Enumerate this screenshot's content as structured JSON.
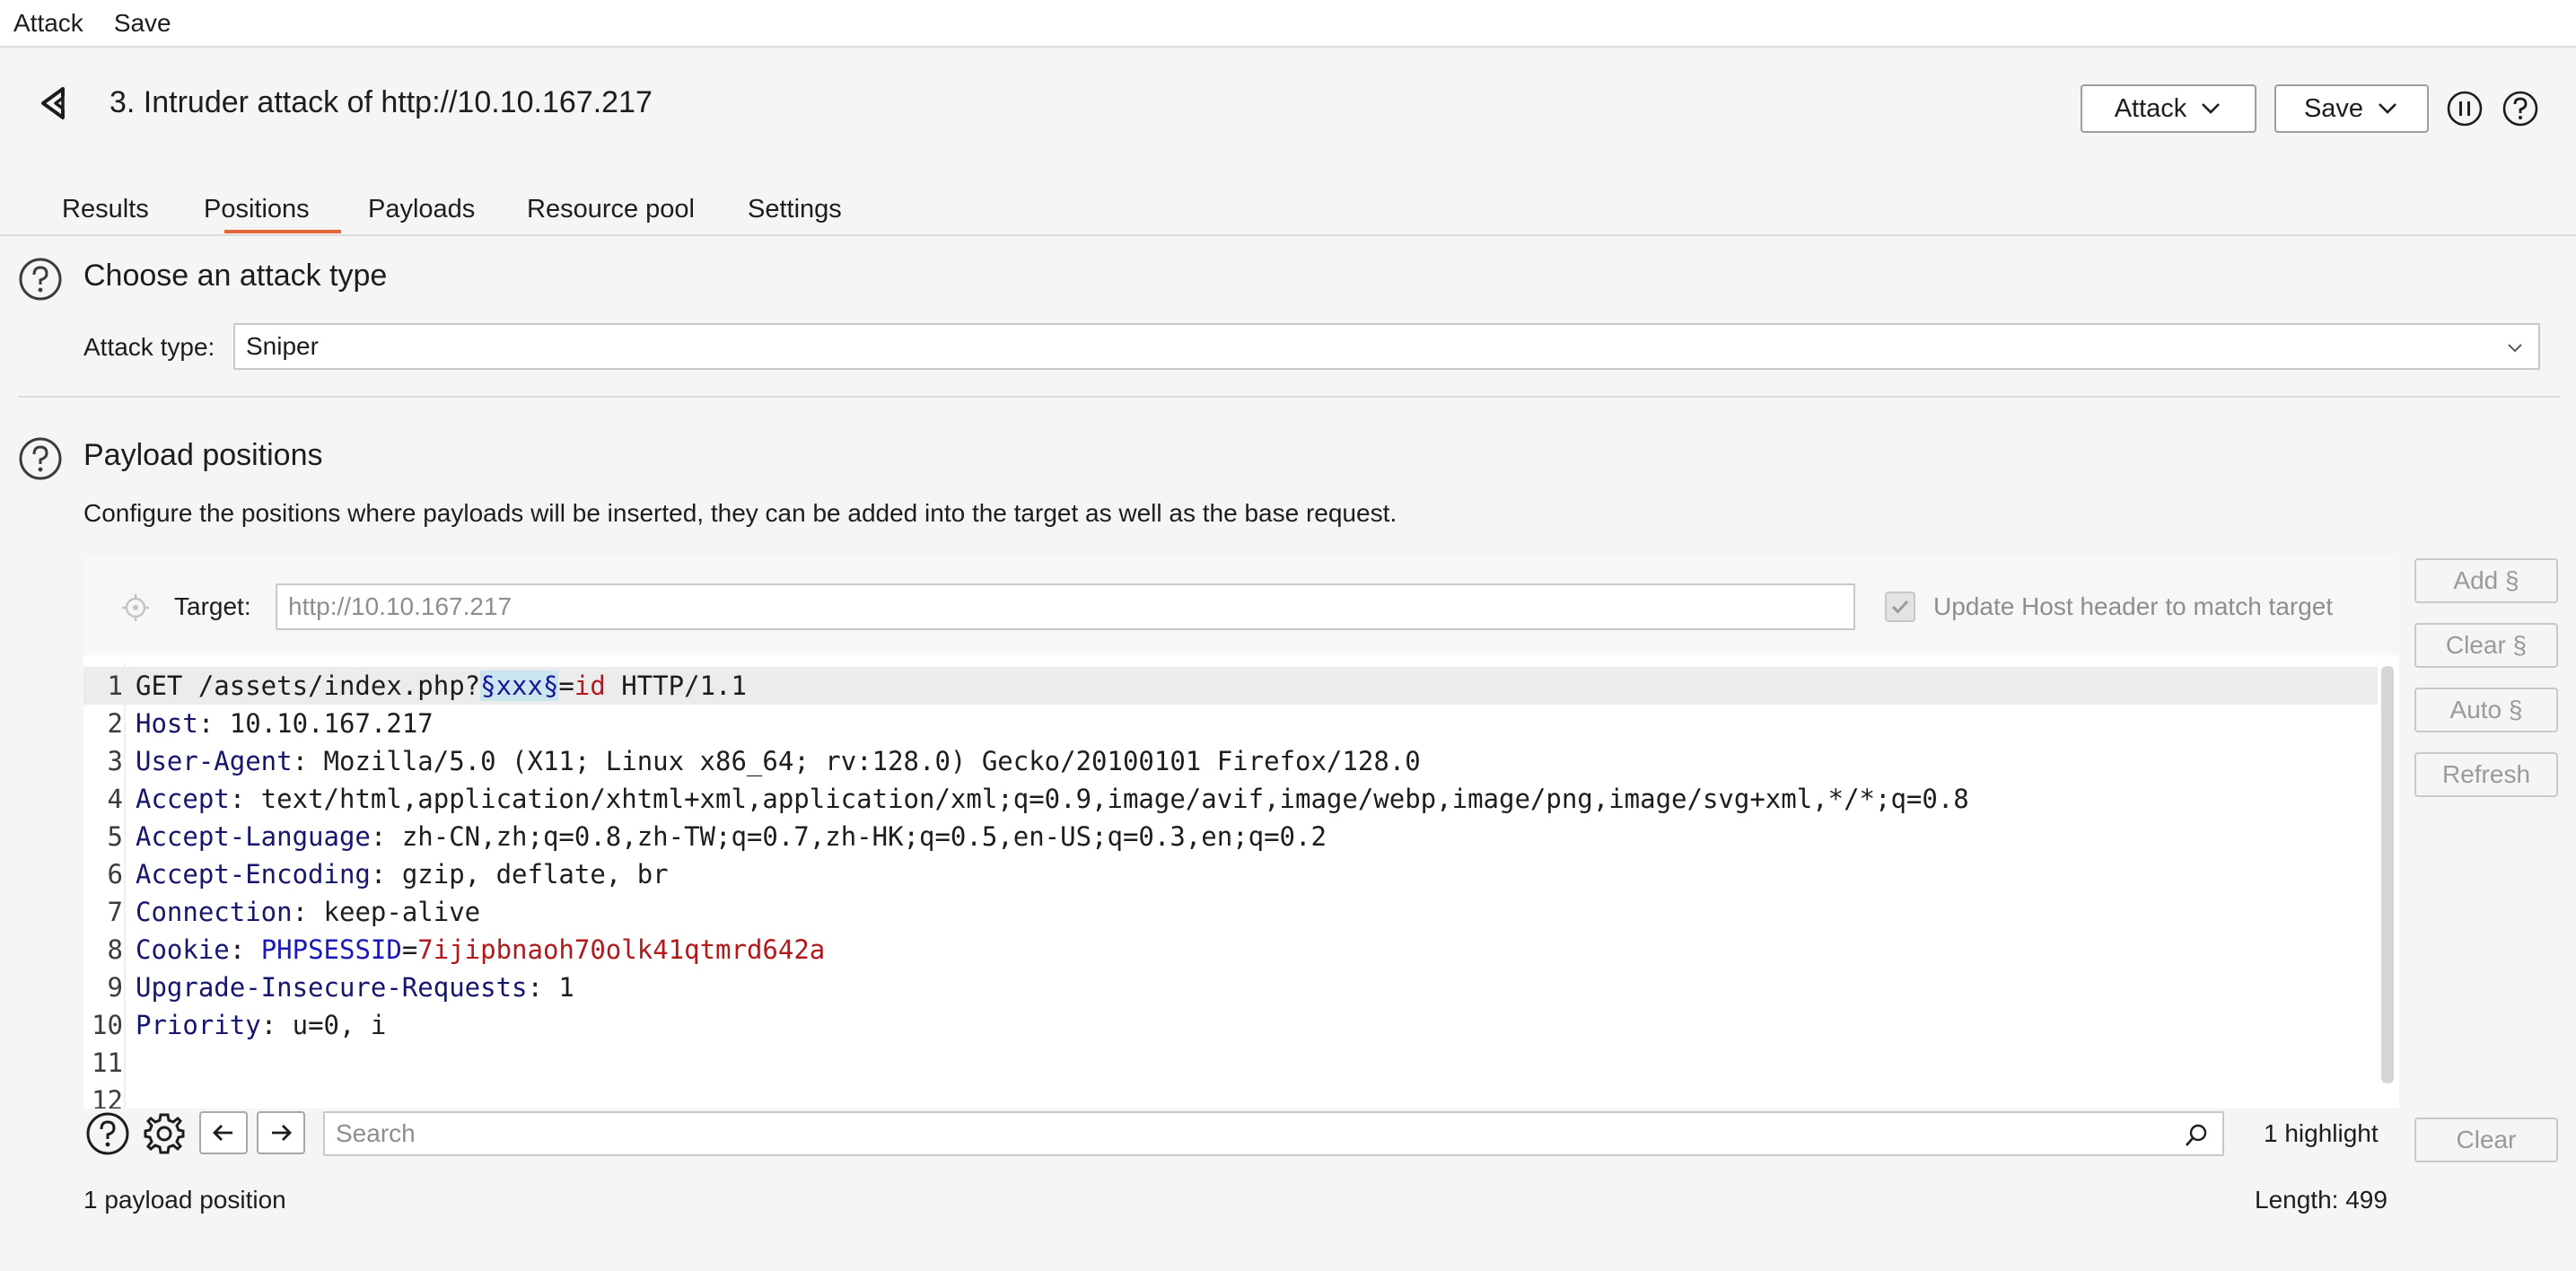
{
  "menubar": {
    "items": [
      "Attack",
      "Save"
    ]
  },
  "header": {
    "title": "3. Intruder attack of http://10.10.167.217",
    "attack_btn": "Attack",
    "save_btn": "Save"
  },
  "tabs": [
    "Results",
    "Positions",
    "Payloads",
    "Resource pool",
    "Settings"
  ],
  "active_tab": "Positions",
  "attack_type_section": {
    "title": "Choose an attack type",
    "label": "Attack type:",
    "value": "Sniper"
  },
  "payload_section": {
    "title": "Payload positions",
    "description": "Configure the positions where payloads will be inserted, they can be added into the target as well as the base request.",
    "target_label": "Target:",
    "target_placeholder": "http://10.10.167.217",
    "update_host_label": "Update Host header to match target",
    "update_host_checked": true
  },
  "side_buttons": [
    "Add §",
    "Clear §",
    "Auto §",
    "Refresh"
  ],
  "request": {
    "line1": {
      "method_path": "GET /assets/index.php?",
      "marker": "§xxx§",
      "eq": "=",
      "param_val": "id",
      "rest": " HTTP/1.1"
    },
    "headers": [
      {
        "n": "2",
        "name": "Host",
        "value": ": 10.10.167.217"
      },
      {
        "n": "3",
        "name": "User-Agent",
        "value": ": Mozilla/5.0 (X11; Linux x86_64; rv:128.0) Gecko/20100101 Firefox/128.0"
      },
      {
        "n": "4",
        "name": "Accept",
        "value": ": text/html,application/xhtml+xml,application/xml;q=0.9,image/avif,image/webp,image/png,image/svg+xml,*/*;q=0.8"
      },
      {
        "n": "5",
        "name": "Accept-Language",
        "value": ": zh-CN,zh;q=0.8,zh-TW;q=0.7,zh-HK;q=0.5,en-US;q=0.3,en;q=0.2"
      },
      {
        "n": "6",
        "name": "Accept-Encoding",
        "value": ": gzip, deflate, br"
      },
      {
        "n": "7",
        "name": "Connection",
        "value": ": keep-alive"
      }
    ],
    "cookie": {
      "n": "8",
      "name": "Cookie",
      "sep": ": ",
      "cname": "PHPSESSID",
      "eq": "=",
      "cval": "7ijipbnaoh70olk41qtmrd642a"
    },
    "headers2": [
      {
        "n": "9",
        "name": "Upgrade-Insecure-Requests",
        "value": ": 1"
      },
      {
        "n": "10",
        "name": "Priority",
        "value": ": u=0, i"
      }
    ],
    "line_numbers_tail": [
      "11",
      "12"
    ]
  },
  "search": {
    "placeholder": "Search",
    "highlight_count": "1 highlight",
    "clear_btn": "Clear"
  },
  "footer": {
    "positions": "1 payload position",
    "length": "Length: 499"
  },
  "colors": {
    "accent": "#e2663a",
    "header_name": "#16166e",
    "param_value": "#b3181b",
    "marker_bg": "#cbe6ef"
  }
}
